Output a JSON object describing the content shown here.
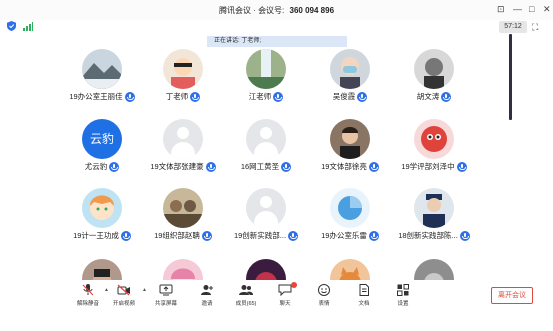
{
  "window": {
    "title_app": "腾讯会议",
    "title_sep": " · ",
    "title_label": "会议号:",
    "meeting_id": "360 094 896"
  },
  "status": {
    "timer": "57:12",
    "speaking": "正在讲话: 丁老师;"
  },
  "participants": [
    {
      "name": "19办公室王丽佳",
      "avatar": "landscape-photo"
    },
    {
      "name": "丁老师",
      "avatar": "cartoon-photo"
    },
    {
      "name": "江老师",
      "avatar": "waterfall-photo"
    },
    {
      "name": "吴俊霞",
      "avatar": "masked-person-photo"
    },
    {
      "name": "胡文涛",
      "avatar": "black-white-photo"
    },
    {
      "name": "尤云豹",
      "avatar": "text-avatar",
      "avatar_text": "云豹",
      "avatar_color": "#1f6fe5"
    },
    {
      "name": "19文体部张建豪",
      "avatar": "default"
    },
    {
      "name": "16网工黄圣",
      "avatar": "default"
    },
    {
      "name": "19文体部徐亮",
      "avatar": "portrait-photo"
    },
    {
      "name": "19学评部刘泽中",
      "avatar": "red-cartoon"
    },
    {
      "name": "19计一王功成",
      "avatar": "anime-photo"
    },
    {
      "name": "19组织部赵聃",
      "avatar": "group-photo"
    },
    {
      "name": "19创新实践部...",
      "avatar": "default"
    },
    {
      "name": "19办公室乐雷",
      "avatar": "pie-icon"
    },
    {
      "name": "18创新实践部陈...",
      "avatar": "uniform-photo"
    },
    {
      "name": "",
      "avatar": "photo-dark"
    },
    {
      "name": "",
      "avatar": "photo-pink"
    },
    {
      "name": "",
      "avatar": "photo-red"
    },
    {
      "name": "",
      "avatar": "photo-cat"
    },
    {
      "name": "",
      "avatar": "photo-grey"
    }
  ],
  "toolbar": {
    "unmute": "解除静音",
    "video": "开启视频",
    "share": "共享屏幕",
    "invite": "邀请",
    "members": "成员(65)",
    "chat": "聊天",
    "reactions": "表情",
    "docs": "文档",
    "settings": "设置",
    "leave": "离开会议"
  },
  "colors": {
    "accent": "#2f6fe8",
    "leave": "#e04a3a"
  }
}
